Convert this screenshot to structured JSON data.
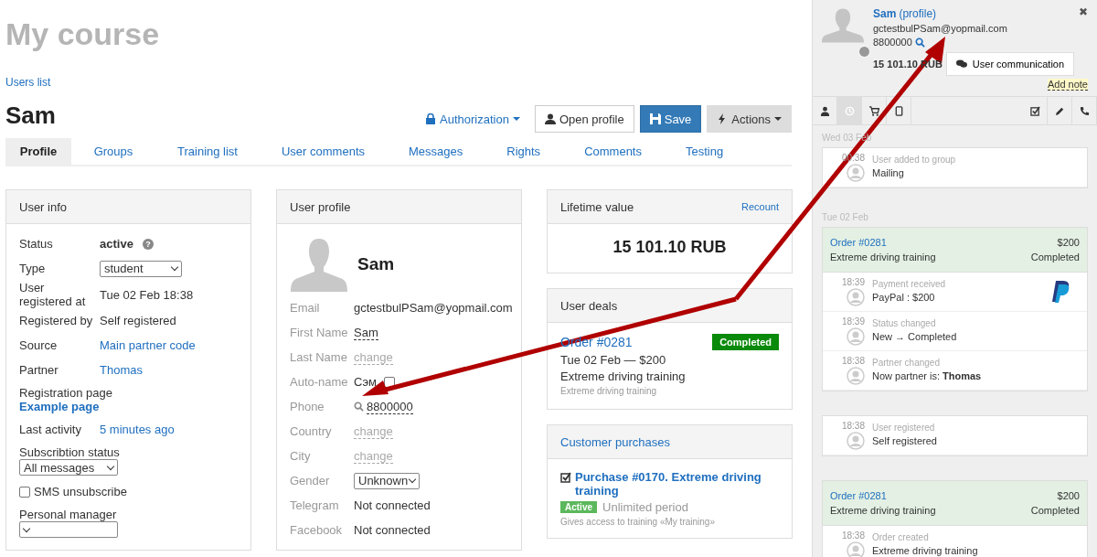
{
  "page_title": "My course",
  "breadcrumb": "Users list",
  "user_name": "Sam",
  "header_buttons": [
    {
      "kind": "dropdown-link",
      "label": "Authorization"
    },
    {
      "kind": "outline",
      "label": "Open profile"
    },
    {
      "kind": "primary",
      "label": "Save"
    },
    {
      "kind": "secondary",
      "label": "Actions"
    }
  ],
  "tabs": [
    {
      "label": "Profile",
      "selected": true
    },
    {
      "label": "Groups",
      "selected": false
    },
    {
      "label": "Training list",
      "selected": false
    },
    {
      "label": "User comments",
      "selected": false
    },
    {
      "label": "Messages",
      "selected": false
    },
    {
      "label": "Rights",
      "selected": false
    },
    {
      "label": "Comments",
      "selected": false
    },
    {
      "label": "Testing",
      "selected": false
    }
  ],
  "user_info": {
    "title": "User info",
    "rows": [
      {
        "kind": "status",
        "label": "Status",
        "value": "active",
        "help": "?"
      },
      {
        "kind": "select",
        "label": "Type",
        "value": "student"
      },
      {
        "kind": "text",
        "label": "User registered at",
        "value": "Tue 02 Feb 18:38"
      },
      {
        "kind": "text",
        "label": "Registered by",
        "value": "Self registered"
      },
      {
        "kind": "link",
        "label": "Source",
        "value": "Main partner code"
      },
      {
        "kind": "link",
        "label": "Partner",
        "value": "Thomas"
      },
      {
        "kind": "stacked-link",
        "label": "Registration page",
        "value": "Example page"
      },
      {
        "kind": "link",
        "label": "Last activity",
        "value": "5 minutes ago"
      },
      {
        "kind": "stacked-select",
        "label": "Subscribtion status",
        "value": "All messages"
      },
      {
        "kind": "checkbox",
        "label": "SMS unsubscribe",
        "checked": false
      },
      {
        "kind": "stacked-select",
        "label": "Personal manager"
      }
    ]
  },
  "user_profile": {
    "title": "User profile",
    "name": "Sam",
    "rows": [
      {
        "kind": "text",
        "label": "Email",
        "value": "gctestbulPSam@yopmail.com"
      },
      {
        "kind": "editable",
        "label": "First Name",
        "value": "Sam"
      },
      {
        "kind": "change",
        "label": "Last Name",
        "value": "change"
      },
      {
        "kind": "autoname",
        "label": "Auto-name",
        "value": "Сэм",
        "checked": false
      },
      {
        "kind": "phone",
        "label": "Phone",
        "value": "8800000"
      },
      {
        "kind": "change",
        "label": "Country",
        "value": "change"
      },
      {
        "kind": "change",
        "label": "City",
        "value": "change"
      },
      {
        "kind": "select",
        "label": "Gender",
        "value": "Unknown"
      },
      {
        "kind": "text",
        "label": "Telegram",
        "value": "Not connected"
      },
      {
        "kind": "text",
        "label": "Facebook",
        "value": "Not connected"
      }
    ]
  },
  "lifetime": {
    "title": "Lifetime value",
    "action": "Recount",
    "value": "15 101.10 RUB"
  },
  "deals": {
    "title": "User deals",
    "items": [
      {
        "order": "Order #0281",
        "status": "Completed",
        "color": "#0a8a0a",
        "date_price": "Tue 02 Feb — $200",
        "product": "Extreme driving training",
        "note": "Extreme driving training"
      }
    ]
  },
  "purchases": {
    "title": "Customer purchases",
    "items": [
      {
        "title": "Purchase #0170. Extreme driving training",
        "badge": "Active",
        "period": "Unlimited period",
        "description": "Gives access to training «My training»"
      }
    ]
  },
  "sidebar": {
    "contact": {
      "name": "Sam",
      "profile_link": "(profile)",
      "email": "gctestbulPSam@yopmail.com",
      "phone": "8800000",
      "amount": "15 101.10 RUB",
      "online": false
    },
    "close": "✖",
    "communication_button": "User communication",
    "add_note": "Add note",
    "toolbar_left": [
      {
        "kind": "user",
        "selected": false
      },
      {
        "kind": "history",
        "selected": true
      },
      {
        "kind": "cart",
        "selected": false
      },
      {
        "kind": "tablet",
        "selected": false
      }
    ],
    "toolbar_right": [
      {
        "kind": "tasks",
        "selected": false
      },
      {
        "kind": "pencil",
        "selected": false
      },
      {
        "kind": "phone",
        "selected": false
      }
    ],
    "feed": [
      {
        "date": "Wed 03 Feb",
        "cards": [
          {
            "kind": "event",
            "events": [
              {
                "time": "00:38",
                "title": "User added to group",
                "text": "Mailing"
              }
            ]
          }
        ]
      },
      {
        "date": "Tue 02 Feb",
        "cards": [
          {
            "kind": "order",
            "order": "Order #0281",
            "amount": "$200",
            "product": "Extreme driving training",
            "status": "Completed",
            "events": [
              {
                "kind": "payment",
                "time": "18:39",
                "title": "Payment received",
                "text": "PayPal : $200"
              },
              {
                "time": "18:39",
                "title": "Status changed",
                "text": "New → Completed"
              },
              {
                "time": "18:38",
                "title": "Partner changed",
                "text": "Now partner is: **Thomas**"
              }
            ]
          },
          {
            "kind": "event",
            "events": [
              {
                "time": "18:38",
                "title": "User registered",
                "text": "Self registered"
              }
            ]
          },
          {
            "kind": "order",
            "order": "Order #0281",
            "amount": "$200",
            "product": "Extreme driving training",
            "status": "Completed",
            "events": [
              {
                "time": "18:38",
                "title": "Order created",
                "text": "Extreme driving training"
              }
            ]
          }
        ]
      }
    ]
  }
}
